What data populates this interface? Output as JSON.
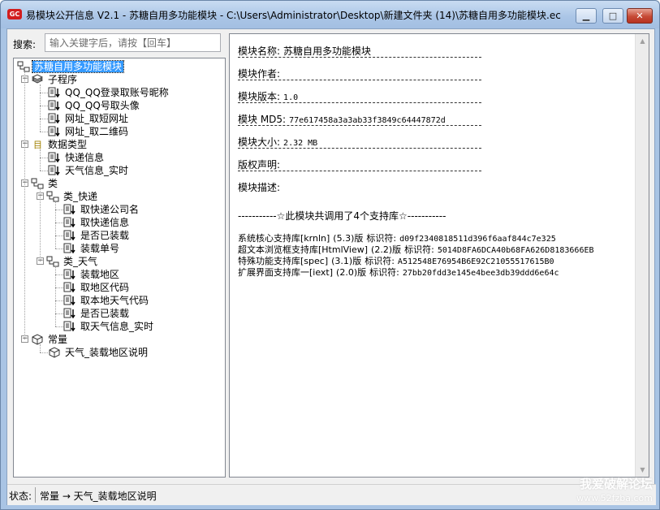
{
  "window": {
    "app_icon_text": "GC",
    "title": "易模块公开信息 V2.1 - 苏糖自用多功能模块 - C:\\Users\\Administrator\\Desktop\\新建文件夹 (14)\\苏糖自用多功能模块.ec",
    "minimize_glyph": "▁",
    "maximize_glyph": "□",
    "close_glyph": "✕"
  },
  "search": {
    "label": "搜索:",
    "placeholder": "输入关键字后，请按【回车】",
    "value": ""
  },
  "tree": {
    "root": "苏糖自用多功能模块",
    "nodes": [
      {
        "label": "子程序",
        "icon": "subprogram-icon",
        "expanded": true,
        "depth": 1
      },
      {
        "label": "QQ_QQ登录取账号昵称",
        "icon": "method-icon",
        "depth": 2
      },
      {
        "label": "QQ_QQ号取头像",
        "icon": "method-icon",
        "depth": 2
      },
      {
        "label": "网址_取短网址",
        "icon": "method-icon",
        "depth": 2
      },
      {
        "label": "网址_取二维码",
        "icon": "method-icon",
        "depth": 2
      },
      {
        "label": "数据类型",
        "icon": "datatype-icon",
        "expanded": true,
        "depth": 1
      },
      {
        "label": "快递信息",
        "icon": "method-icon",
        "depth": 2
      },
      {
        "label": "天气信息_实时",
        "icon": "method-icon",
        "depth": 2
      },
      {
        "label": "类",
        "icon": "class-icon",
        "expanded": true,
        "depth": 1
      },
      {
        "label": "类_快递",
        "icon": "class-icon",
        "expanded": true,
        "depth": 2
      },
      {
        "label": "取快递公司名",
        "icon": "method-icon",
        "depth": 3
      },
      {
        "label": "取快递信息",
        "icon": "method-icon",
        "depth": 3
      },
      {
        "label": "是否已装载",
        "icon": "method-icon",
        "depth": 3
      },
      {
        "label": "装载单号",
        "icon": "method-icon",
        "depth": 3
      },
      {
        "label": "类_天气",
        "icon": "class-icon",
        "expanded": true,
        "depth": 2
      },
      {
        "label": "装载地区",
        "icon": "method-icon",
        "depth": 3
      },
      {
        "label": "取地区代码",
        "icon": "method-icon",
        "depth": 3
      },
      {
        "label": "取本地天气代码",
        "icon": "method-icon",
        "depth": 3
      },
      {
        "label": "是否已装载",
        "icon": "method-icon",
        "depth": 3
      },
      {
        "label": "取天气信息_实时",
        "icon": "method-icon",
        "depth": 3
      },
      {
        "label": "常量",
        "icon": "constant-icon",
        "expanded": true,
        "depth": 1
      },
      {
        "label": "天气_装载地区说明",
        "icon": "constant-icon",
        "depth": 2
      }
    ]
  },
  "info": {
    "fields": [
      {
        "key": "模块名称:",
        "value": "苏糖自用多功能模块",
        "mono": false
      },
      {
        "key": "模块作者:",
        "value": "",
        "mono": false
      },
      {
        "key": "模块版本:",
        "value": "1.0",
        "mono": true
      },
      {
        "key": "模块 MD5:",
        "value": "77e617458a3a3ab33f3849c64447872d",
        "mono": true
      },
      {
        "key": "模块大小:",
        "value": "2.32 MB",
        "mono": true
      },
      {
        "key": "版权声明:",
        "value": "",
        "mono": false
      },
      {
        "key": "模块描述:",
        "value": "",
        "mono": false
      }
    ],
    "support_title": "-----------☆此模块共调用了4个支持库☆-----------",
    "support_libs": [
      {
        "name": "系统核心支持库[krnln]",
        "version": "(5.3)版",
        "id_label": "标识符:",
        "id": "d09f2340818511d396f6aaf844c7e325"
      },
      {
        "name": "超文本浏览框支持库[HtmlView]",
        "version": "(2.2)版",
        "id_label": "标识符:",
        "id": "5014D8FA6DCA40b68FA626D8183666EB"
      },
      {
        "name": "特殊功能支持库[spec]",
        "version": "(3.1)版",
        "id_label": "标识符:",
        "id": "A512548E76954B6E92C21055517615B0"
      },
      {
        "name": "扩展界面支持库一[iext]",
        "version": "(2.0)版",
        "id_label": "标识符:",
        "id": "27bb20fdd3e145e4bee3db39ddd6e64c"
      }
    ]
  },
  "status": {
    "label": "状态:",
    "text": "常量 → 天气_装载地区说明"
  },
  "watermark": {
    "line1": "我爱破解论坛",
    "line2": "www.52fzba.com"
  }
}
